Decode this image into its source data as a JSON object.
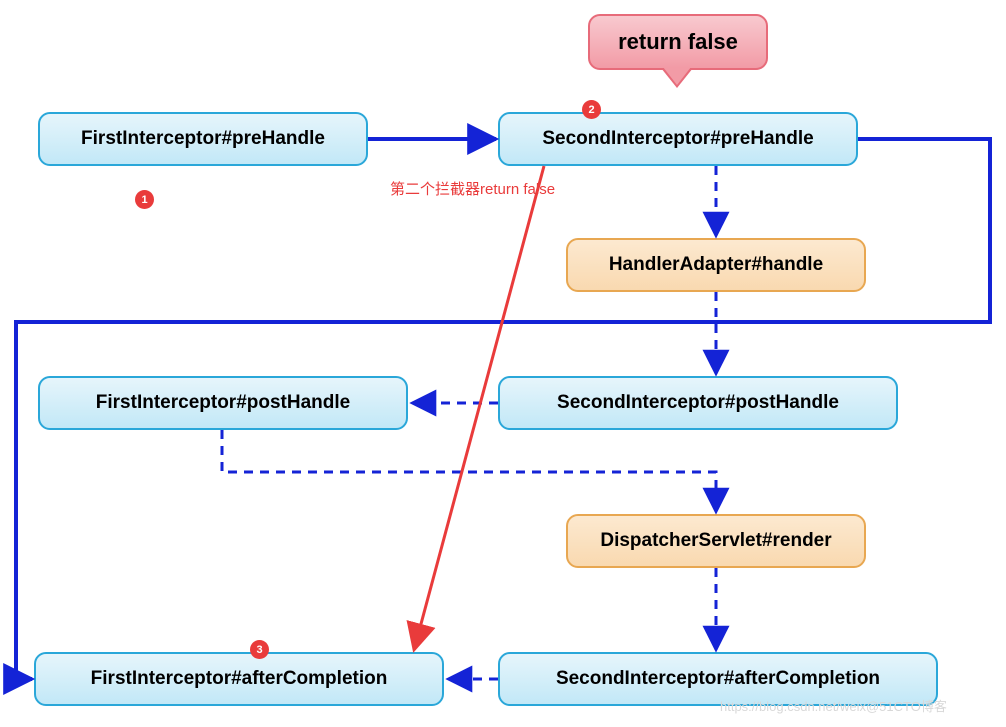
{
  "callout": {
    "text": "return false"
  },
  "nodes": {
    "first_pre": {
      "label": "FirstInterceptor#preHandle"
    },
    "second_pre": {
      "label": "SecondInterceptor#preHandle"
    },
    "handler": {
      "label": "HandlerAdapter#handle"
    },
    "first_post": {
      "label": "FirstInterceptor#postHandle"
    },
    "second_post": {
      "label": "SecondInterceptor#postHandle"
    },
    "render": {
      "label": "DispatcherServlet#render"
    },
    "first_after": {
      "label": "FirstInterceptor#afterCompletion"
    },
    "second_after": {
      "label": "SecondInterceptor#afterCompletion"
    }
  },
  "badges": {
    "one": "1",
    "two": "2",
    "three": "3"
  },
  "annotation": {
    "red_note": "第二个拦截器return false"
  },
  "watermark": {
    "text": "https://blog.csdn.net/weix@51CTO博客"
  },
  "diagram_data": {
    "type": "flowchart",
    "description": "Spring MVC interceptor chain when SecondInterceptor#preHandle returns false",
    "nodes": [
      {
        "id": "first_pre",
        "label": "FirstInterceptor#preHandle",
        "kind": "interceptor",
        "order_badge": 1
      },
      {
        "id": "second_pre",
        "label": "SecondInterceptor#preHandle",
        "kind": "interceptor",
        "order_badge": 2,
        "callout": "return false"
      },
      {
        "id": "handler",
        "label": "HandlerAdapter#handle",
        "kind": "handler"
      },
      {
        "id": "first_post",
        "label": "FirstInterceptor#postHandle",
        "kind": "interceptor"
      },
      {
        "id": "second_post",
        "label": "SecondInterceptor#postHandle",
        "kind": "interceptor"
      },
      {
        "id": "render",
        "label": "DispatcherServlet#render",
        "kind": "handler"
      },
      {
        "id": "first_after",
        "label": "FirstInterceptor#afterCompletion",
        "kind": "interceptor",
        "order_badge": 3
      },
      {
        "id": "second_after",
        "label": "SecondInterceptor#afterCompletion",
        "kind": "interceptor"
      }
    ],
    "edges": [
      {
        "from": "first_pre",
        "to": "second_pre",
        "style": "solid",
        "color": "blue",
        "meaning": "normal-flow"
      },
      {
        "from": "second_pre",
        "to": "handler",
        "style": "dashed",
        "color": "blue",
        "meaning": "would-execute"
      },
      {
        "from": "handler",
        "to": "second_post",
        "style": "dashed",
        "color": "blue",
        "meaning": "would-execute"
      },
      {
        "from": "second_post",
        "to": "first_post",
        "style": "dashed",
        "color": "blue",
        "meaning": "would-execute"
      },
      {
        "from": "first_post",
        "to": "render",
        "style": "dashed",
        "color": "blue",
        "meaning": "would-execute (routed)"
      },
      {
        "from": "render",
        "to": "second_after",
        "style": "dashed",
        "color": "blue",
        "meaning": "would-execute"
      },
      {
        "from": "second_after",
        "to": "first_after",
        "style": "dashed",
        "color": "blue",
        "meaning": "would-execute"
      },
      {
        "from": "second_pre",
        "to": "first_after",
        "style": "solid",
        "color": "blue",
        "meaning": "actual-flow-on-false (routed around)"
      },
      {
        "from": "second_pre",
        "to": "first_after",
        "style": "solid",
        "color": "red",
        "meaning": "return-false-shortcut",
        "label": "第二个拦截器return false"
      }
    ],
    "colors": {
      "interceptor_fill": "#c2e8f7",
      "handler_fill": "#f9d9b0",
      "callout_fill": "#f29ba6",
      "solid_edge": "#1423d6",
      "dashed_edge": "#1423d6",
      "shortcut_edge": "#e93b3b"
    }
  }
}
